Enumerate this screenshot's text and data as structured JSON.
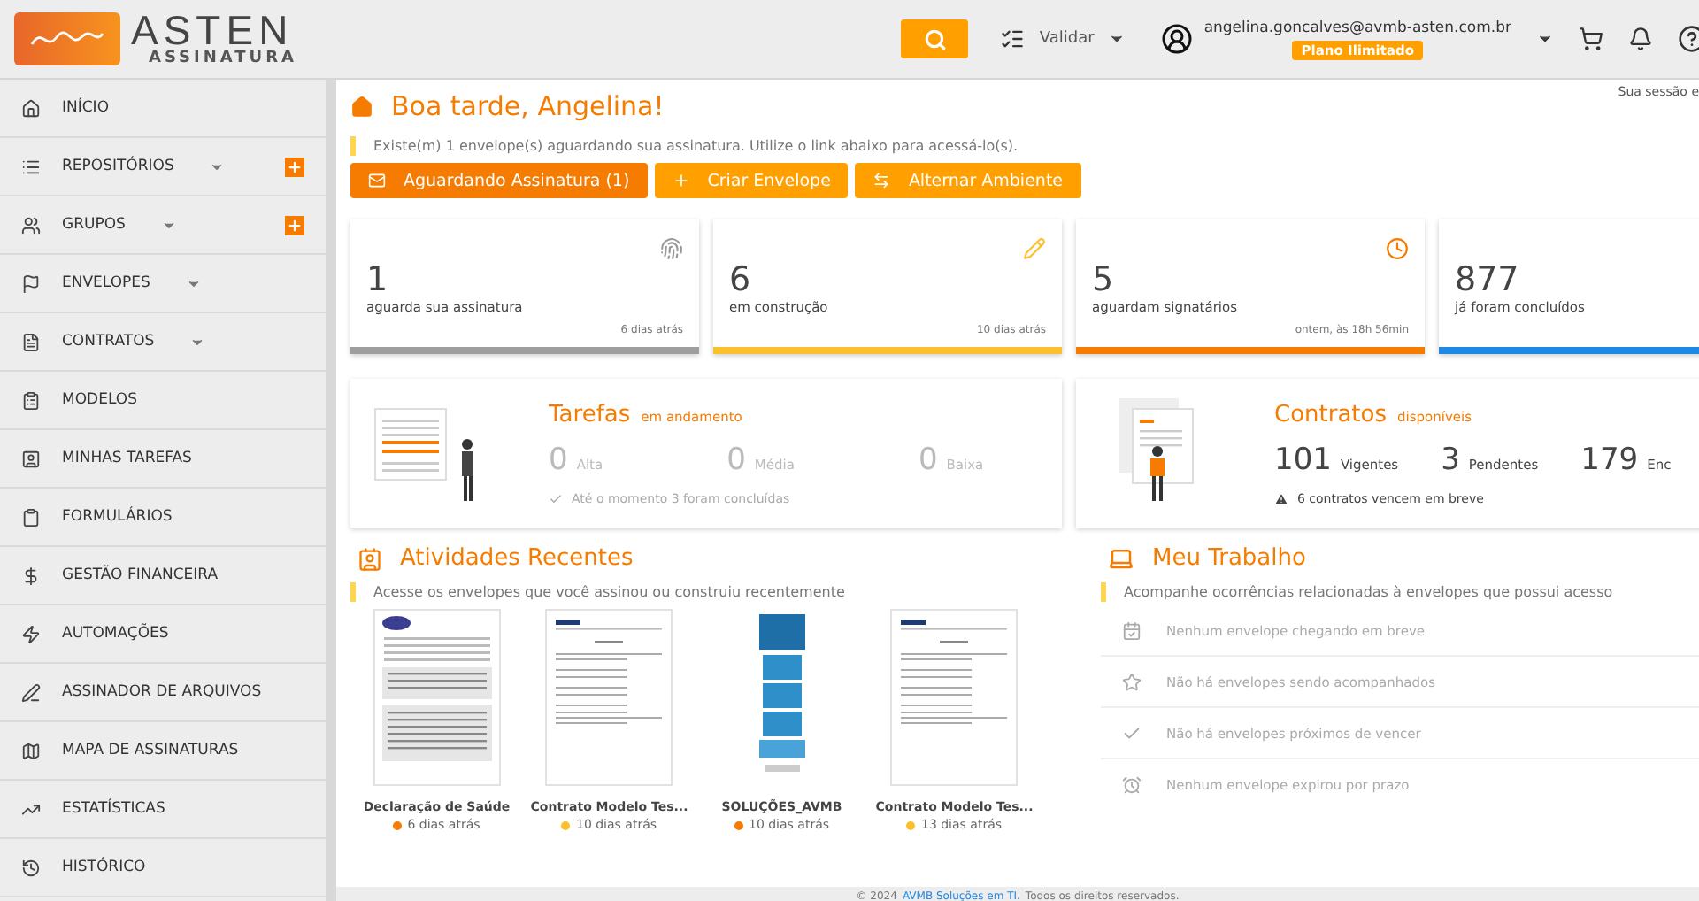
{
  "header": {
    "logo_word": "ASTEN",
    "logo_sub": "ASSINATURA",
    "validate_label": "Validar",
    "user_email": "angelina.goncalves@avmb-asten.com.br",
    "plan_badge": "Plano Ilimitado",
    "session_note": "Sua sessão e"
  },
  "sidebar": {
    "items": [
      {
        "label": "INÍCIO",
        "has_submenu": false,
        "add_button": false
      },
      {
        "label": "REPOSITÓRIOS",
        "has_submenu": true,
        "add_button": true
      },
      {
        "label": "GRUPOS",
        "has_submenu": true,
        "add_button": true
      },
      {
        "label": "ENVELOPES",
        "has_submenu": true,
        "add_button": false
      },
      {
        "label": "CONTRATOS",
        "has_submenu": true,
        "add_button": false
      },
      {
        "label": "MODELOS",
        "has_submenu": false,
        "add_button": false
      },
      {
        "label": "MINHAS TAREFAS",
        "has_submenu": false,
        "add_button": false
      },
      {
        "label": "FORMULÁRIOS",
        "has_submenu": false,
        "add_button": false
      },
      {
        "label": "GESTÃO FINANCEIRA",
        "has_submenu": false,
        "add_button": false
      },
      {
        "label": "AUTOMAÇÕES",
        "has_submenu": false,
        "add_button": false
      },
      {
        "label": "ASSINADOR DE ARQUIVOS",
        "has_submenu": false,
        "add_button": false
      },
      {
        "label": "MAPA DE ASSINATURAS",
        "has_submenu": false,
        "add_button": false
      },
      {
        "label": "ESTATÍSTICAS",
        "has_submenu": false,
        "add_button": false
      },
      {
        "label": "HISTÓRICO",
        "has_submenu": false,
        "add_button": false
      }
    ]
  },
  "greeting": {
    "title": "Boa tarde, Angelina!",
    "notice": "Existe(m) 1 envelope(s) aguardando sua assinatura. Utilize o link abaixo para acessá-lo(s)."
  },
  "actions": [
    {
      "label": "Aguardando Assinatura (1)",
      "kind": "primary"
    },
    {
      "label": "Criar Envelope",
      "kind": "secondary"
    },
    {
      "label": "Alternar Ambiente",
      "kind": "secondary"
    }
  ],
  "stats": [
    {
      "value": "1",
      "label": "aguarda sua assinatura",
      "time": "6 dias atrás",
      "color": "#9e9e9e"
    },
    {
      "value": "6",
      "label": "em construção",
      "time": "10 dias atrás",
      "color": "#fbc02d"
    },
    {
      "value": "5",
      "label": "aguardam signatários",
      "time": "ontem, às 18h 56min",
      "color": "#f57c00"
    },
    {
      "value": "877",
      "label": "já foram concluídos",
      "color": "#1e88e5"
    }
  ],
  "tasks": {
    "title": "Tarefas",
    "subtitle": "em andamento",
    "counts": [
      {
        "value": "0",
        "label": "Alta"
      },
      {
        "value": "0",
        "label": "Média"
      },
      {
        "value": "0",
        "label": "Baixa"
      }
    ],
    "note": "Até o momento 3 foram concluídas"
  },
  "contracts": {
    "title": "Contratos",
    "subtitle": "disponíveis",
    "counts": [
      {
        "value": "101",
        "label": "Vigentes"
      },
      {
        "value": "3",
        "label": "Pendentes"
      },
      {
        "value": "179",
        "label": "Enc"
      }
    ],
    "note": "6 contratos vencem em breve"
  },
  "recent": {
    "title": "Atividades Recentes",
    "subtitle": "Acesse os envelopes que você assinou ou construiu recentemente",
    "documents": [
      {
        "name": "Declaração de Saúde",
        "time": "6 dias atrás",
        "color": "#f57c00",
        "kind": "form"
      },
      {
        "name": "Contrato Modelo Tes...",
        "time": "10 dias atrás",
        "color": "#fbc02d",
        "kind": "contract"
      },
      {
        "name": "SOLUÇÕES_AVMB",
        "time": "10 dias atrás",
        "color": "#f57c00",
        "kind": "brochure"
      },
      {
        "name": "Contrato Modelo Tes...",
        "time": "13 dias atrás",
        "color": "#fbc02d",
        "kind": "contract"
      }
    ]
  },
  "work": {
    "title": "Meu Trabalho",
    "subtitle": "Acompanhe ocorrências relacionadas à envelopes que possui acesso",
    "items": [
      "Nenhum envelope chegando em breve",
      "Não há envelopes sendo acompanhados",
      "Não há envelopes próximos de vencer",
      "Nenhum envelope expirou por prazo"
    ]
  },
  "footer": {
    "year": "© 2024",
    "link": "AVMB Soluções em TI.",
    "rest": "Todos os direitos reservados."
  }
}
